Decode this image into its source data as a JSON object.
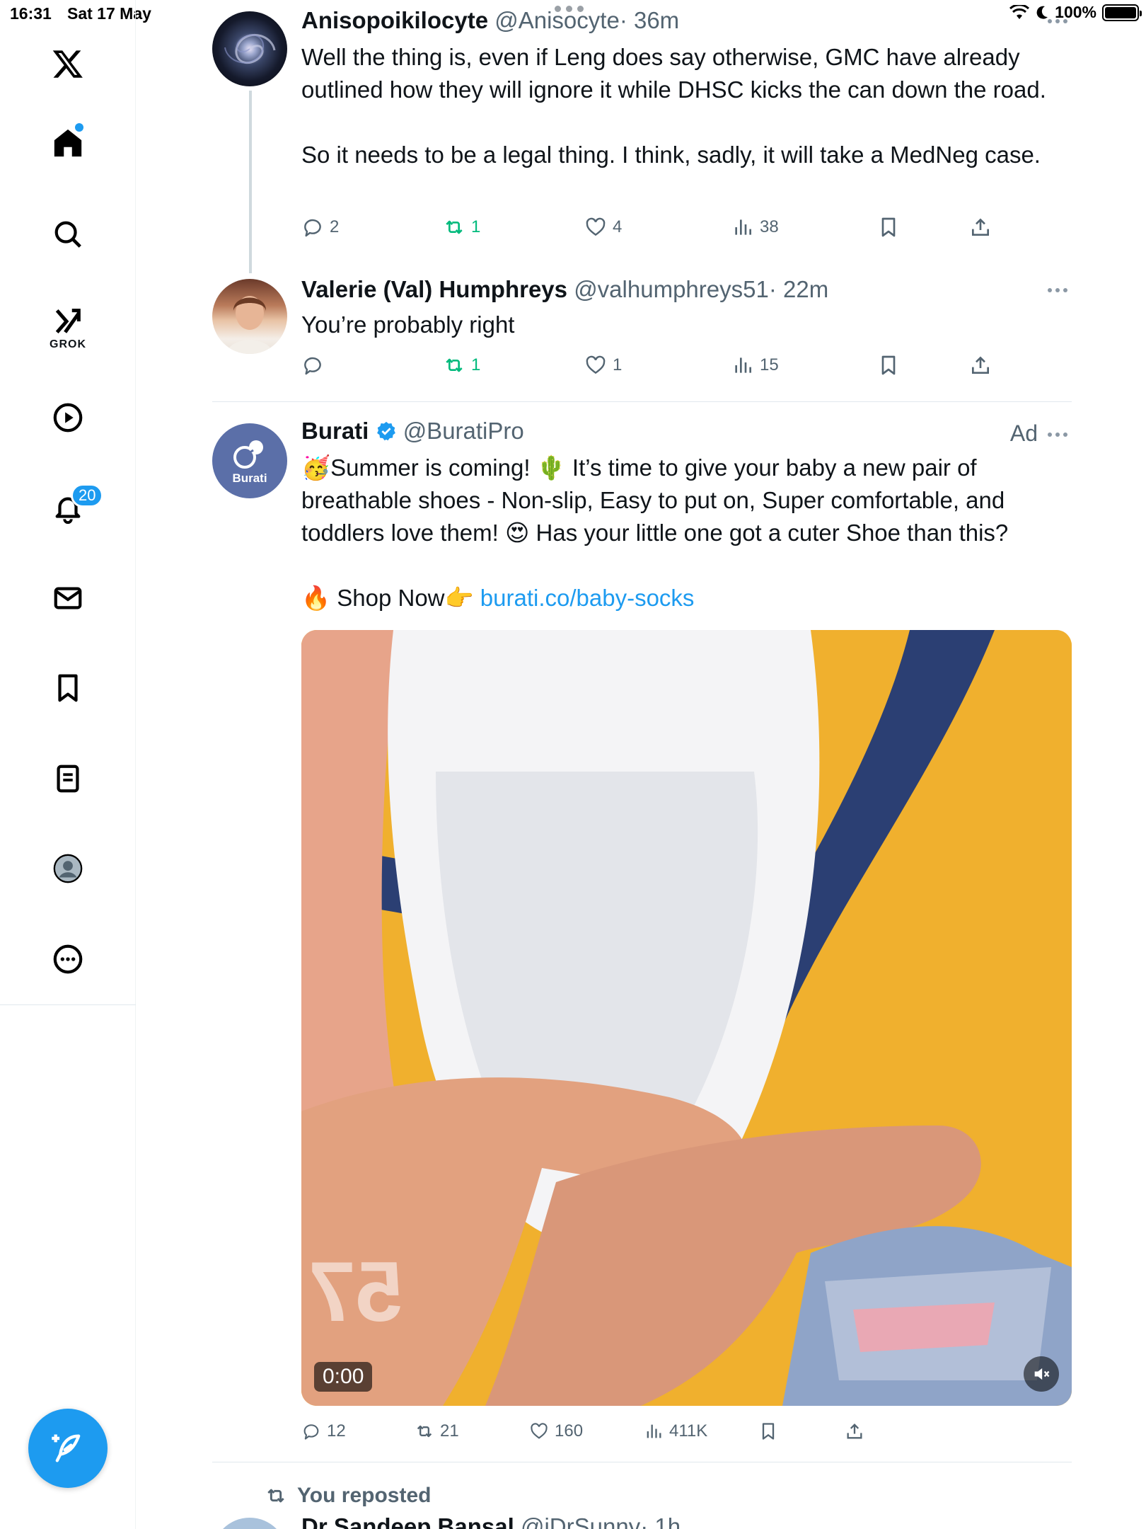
{
  "status_bar": {
    "time": "16:31",
    "date": "Sat 17 May",
    "battery": "100%"
  },
  "sidebar": {
    "grok_label": "GROK",
    "notifications_count": "20"
  },
  "tweets": [
    {
      "name": "Anisopoikilocyte",
      "handle": "@Anisocyte",
      "time": "· 36m",
      "text": "Well the thing is, even if Leng does say otherwise, GMC have already outlined how they will ignore it while DHSC kicks the can down the road.\n\nSo it needs to be a legal thing. I think, sadly, it will take a MedNeg case.",
      "replies": "2",
      "reposts": "1",
      "likes": "4",
      "views": "38"
    },
    {
      "name": "Valerie (Val) Humphreys",
      "handle": "@valhumphreys51",
      "time": "· 22m",
      "text": "You’re probably right",
      "replies": "",
      "reposts": "1",
      "likes": "1",
      "views": "15"
    },
    {
      "name": "Burati",
      "handle": "@BuratiPro",
      "ad_label": "Ad",
      "avatar_text": "Burati",
      "text_line1": "🥳Summer is coming! 🌵 It’s time to give your baby a new pair of breathable shoes - Non-slip, Easy to put on, Super comfortable, and toddlers love them! 😍 Has your little one got a cuter Shoe than this?",
      "text_shop": "🔥 Shop Now👉 ",
      "link": "burati.co/baby-socks",
      "video_time": "0:00",
      "video_overlay": "57",
      "replies": "12",
      "reposts": "21",
      "likes": "160",
      "views": "411K"
    }
  ],
  "repost_banner": "You reposted",
  "next_tweet": {
    "name": "Dr Sandeep Bansal",
    "handle": "@iDrSunny",
    "time": "· 1h"
  },
  "colors": {
    "accent": "#1d9bf0",
    "repost_green": "#00ba7c",
    "secondary_text": "#536471"
  }
}
